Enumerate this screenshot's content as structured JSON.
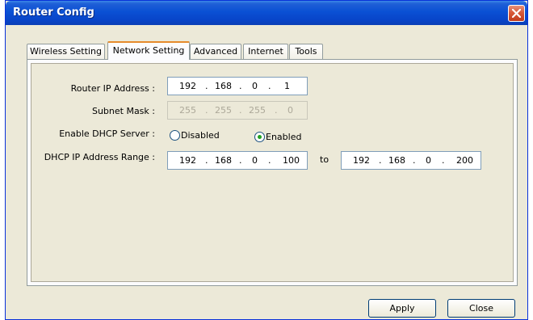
{
  "window": {
    "title": "Router Config"
  },
  "tabs": [
    {
      "label": "Wireless Setting"
    },
    {
      "label": "Network Setting"
    },
    {
      "label": "Advanced"
    },
    {
      "label": "Internet"
    },
    {
      "label": "Tools"
    }
  ],
  "active_tab": "Network Setting",
  "network": {
    "router_ip_label": "Router IP Address :",
    "router_ip": [
      "192",
      "168",
      "0",
      "1"
    ],
    "subnet_label": "Subnet Mask :",
    "subnet": [
      "255",
      "255",
      "255",
      "0"
    ],
    "dhcp_label": "Enable DHCP Server :",
    "dhcp_disabled_label": "Disabled",
    "dhcp_enabled_label": "Enabled",
    "dhcp_selected": "Enabled",
    "range_label": "DHCP IP Address Range :",
    "range_start": [
      "192",
      "168",
      "0",
      "100"
    ],
    "range_to": "to",
    "range_end": [
      "192",
      "168",
      "0",
      "200"
    ],
    "dot": "."
  },
  "buttons": {
    "apply": "Apply",
    "close": "Close"
  },
  "colors": {
    "title_bar": "#0a50d4",
    "active_tab_accent": "#e68b2c",
    "window_bg": "#ece9d8",
    "close_button": "#d85a3a"
  }
}
